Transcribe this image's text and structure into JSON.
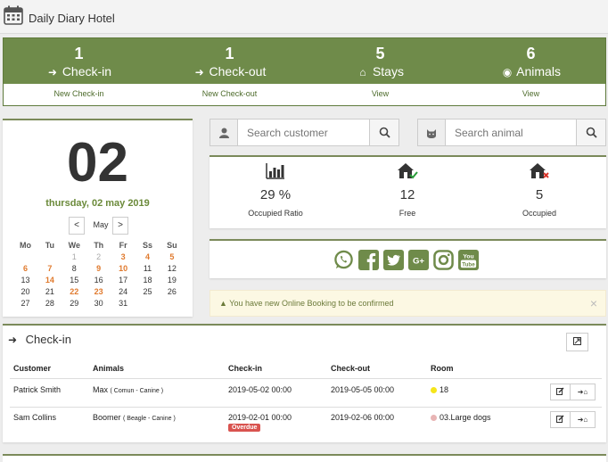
{
  "app": {
    "title": "Daily Diary Hotel",
    "logo_icon": "calendar-icon"
  },
  "stats": [
    {
      "count": "1",
      "label": "Check-in",
      "icon": "sign-in-icon",
      "link": "New Check-in"
    },
    {
      "count": "1",
      "label": "Check-out",
      "icon": "sign-out-icon",
      "link": "New Check-out"
    },
    {
      "count": "5",
      "label": "Stays",
      "icon": "home-icon",
      "link": "View"
    },
    {
      "count": "6",
      "label": "Animals",
      "icon": "cat-icon",
      "link": "View"
    }
  ],
  "datepanel": {
    "day": "02",
    "long_date": "thursday, 02 may 2019",
    "month": "May",
    "prev": "<",
    "next": ">",
    "weekdays": [
      "Mo",
      "Tu",
      "We",
      "Th",
      "Fr",
      "Ss",
      "Su"
    ],
    "weeks": [
      [
        "",
        "",
        "1",
        "2",
        "3",
        "4",
        "5"
      ],
      [
        "6",
        "7",
        "8",
        "9",
        "10",
        "11",
        "12"
      ],
      [
        "13",
        "14",
        "15",
        "16",
        "17",
        "18",
        "19"
      ],
      [
        "20",
        "21",
        "22",
        "23",
        "24",
        "25",
        "26"
      ],
      [
        "27",
        "28",
        "29",
        "30",
        "31",
        "",
        ""
      ]
    ],
    "greyed_days": [
      "1",
      "2"
    ],
    "highlighted_days": [
      "3",
      "4",
      "5",
      "6",
      "7",
      "9",
      "10",
      "14",
      "22",
      "23"
    ]
  },
  "search": {
    "customer_placeholder": "Search customer",
    "animal_placeholder": "Search animal"
  },
  "occupancy": [
    {
      "icon": "bar-chart-icon",
      "value": "29 %",
      "label": "Occupied Ratio"
    },
    {
      "icon": "home-check-icon",
      "value": "12",
      "label": "Free"
    },
    {
      "icon": "home-x-icon",
      "value": "5",
      "label": "Occupied"
    }
  ],
  "social": [
    "whatsapp-icon",
    "facebook-icon",
    "twitter-icon",
    "google-plus-icon",
    "instagram-icon",
    "youtube-icon"
  ],
  "social_labels": {
    "google_plus": "G+",
    "youtube_top": "You",
    "youtube_bottom": "Tube"
  },
  "alert": {
    "text": "You have new Online Booking to be confirmed",
    "close": "×"
  },
  "checkin": {
    "title": "Check-in",
    "columns": [
      "Customer",
      "Animals",
      "Check-in",
      "Check-out",
      "Room"
    ],
    "rows": [
      {
        "customer": "Patrick Smith",
        "animal": "Max",
        "animal_detail": "( Comun - Canine )",
        "checkin": "2019-05-02 00:00",
        "checkout": "2019-05-05 00:00",
        "room": "18",
        "room_color": "#f5e51b",
        "badge": ""
      },
      {
        "customer": "Sam Collins",
        "animal": "Boomer",
        "animal_detail": "( Beagle - Canine )",
        "checkin": "2019-02-01 00:00",
        "checkout": "2019-02-06 00:00",
        "room": "03.Large dogs",
        "room_color": "#e8b4b4",
        "badge": "Overdue"
      }
    ]
  },
  "colors": {
    "brand_green": "#6f8b4a",
    "link_green": "#4d6b2b",
    "accent_orange": "#e07a2e",
    "danger": "#d9534f"
  }
}
